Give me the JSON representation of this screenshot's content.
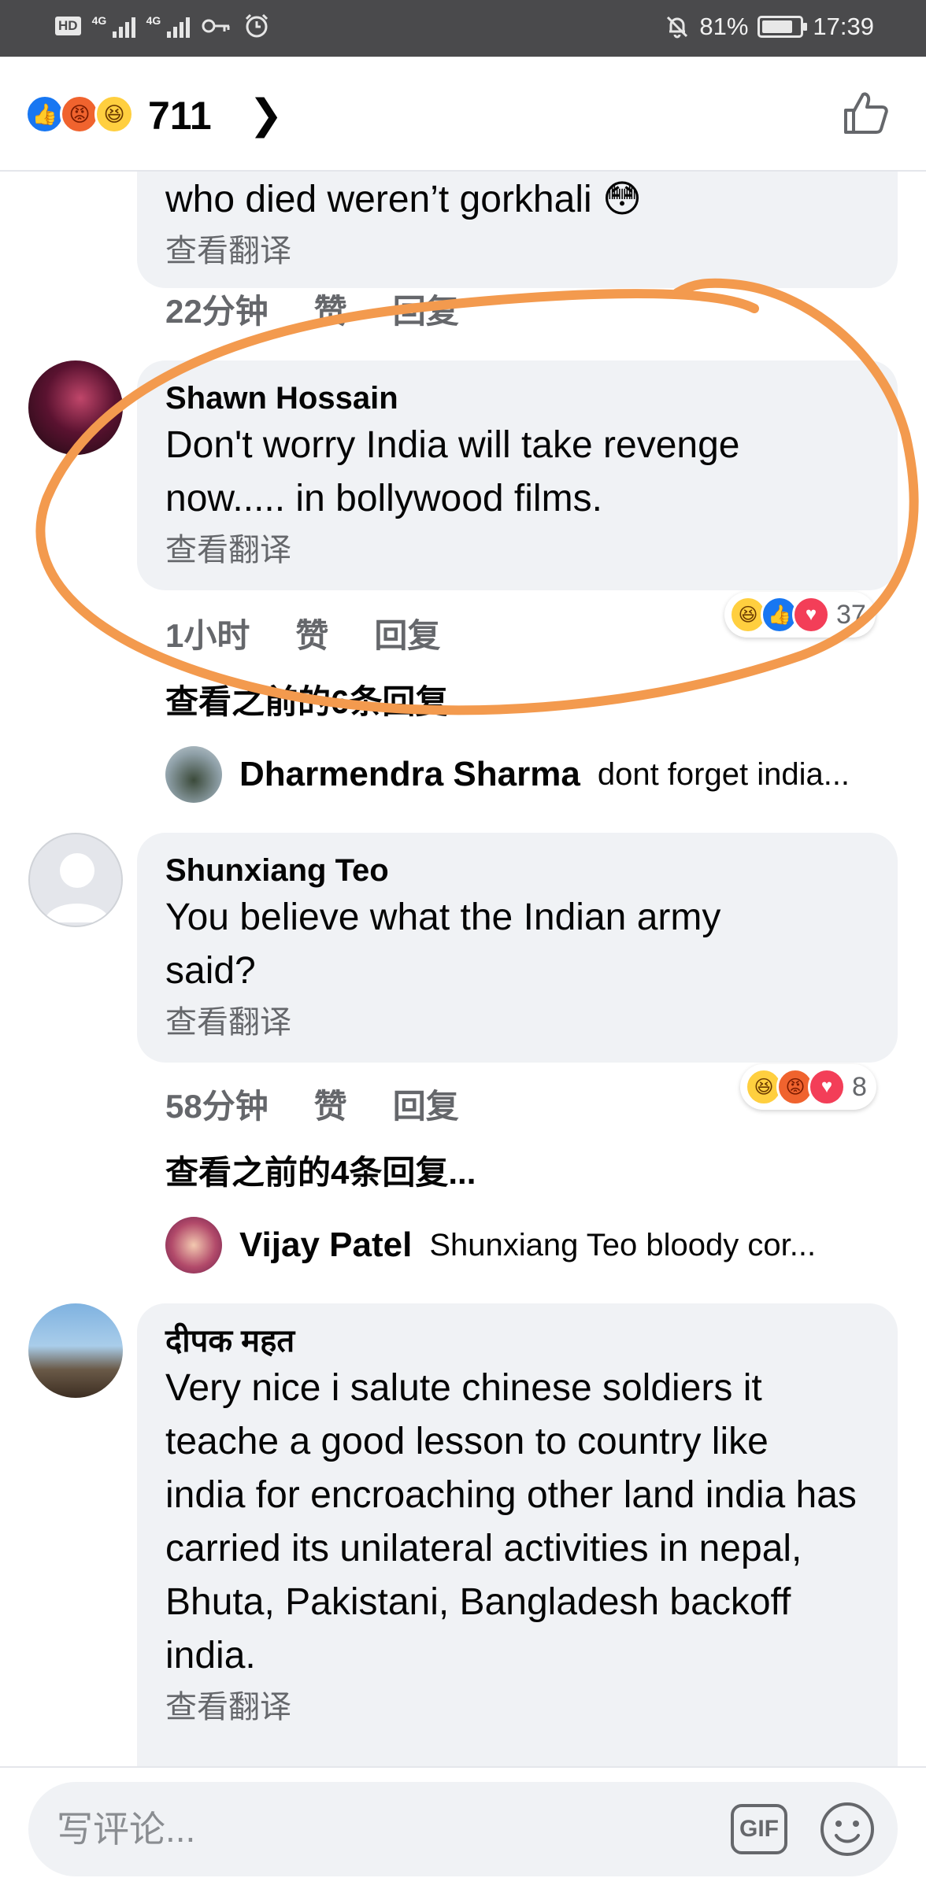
{
  "status_bar": {
    "left_chip": "HD",
    "net1": "4G",
    "net2": "4G",
    "battery_percent": "81%",
    "time": "17:39"
  },
  "header": {
    "reaction_count": "711",
    "reactions": [
      "like",
      "angry",
      "haha"
    ]
  },
  "comments": [
    {
      "partial": true,
      "text": "who died weren’t gorkhali 😳",
      "translate_label": "查看翻译",
      "time": "22分钟",
      "like_label": "赞",
      "reply_label": "回复"
    },
    {
      "name": "Shawn Hossain",
      "text": "Don't worry India will take revenge now..... in bollywood films.",
      "translate_label": "查看翻译",
      "time": "1小时",
      "like_label": "赞",
      "reply_label": "回复",
      "reactions": [
        "haha",
        "like",
        "love"
      ],
      "reaction_count": "37",
      "more_replies": "查看之前的6条回复...",
      "reply_preview": {
        "name": "Dharmendra Sharma",
        "text": "dont forget india..."
      }
    },
    {
      "name": "Shunxiang Teo",
      "text": "You believe what the Indian army said?",
      "translate_label": "查看翻译",
      "time": "58分钟",
      "like_label": "赞",
      "reply_label": "回复",
      "reactions": [
        "haha",
        "angry",
        "love"
      ],
      "reaction_count": "8",
      "more_replies": "查看之前的4条回复...",
      "reply_preview": {
        "name": "Vijay Patel",
        "text": "Shunxiang Teo  bloody cor..."
      }
    },
    {
      "name": "दीपक महत",
      "text": "Very nice i salute chinese soldiers it teache a good lesson to country like india for encroaching other land india has carried its unilateral activities in nepal, Bhuta, Pakistani, Bangladesh backoff india.",
      "translate_label": "查看翻译"
    }
  ],
  "composer": {
    "placeholder": "写评论...",
    "gif_label": "GIF"
  },
  "colors": {
    "like_blue": "#1877f2",
    "bubble_bg": "#f0f2f5",
    "annotation_orange": "#f39a4e"
  },
  "icons": [
    "like-reaction-icon",
    "angry-reaction-icon",
    "haha-reaction-icon",
    "love-reaction-icon",
    "chevron-right-icon",
    "thumbs-up-icon",
    "gif-icon",
    "smiley-icon"
  ]
}
